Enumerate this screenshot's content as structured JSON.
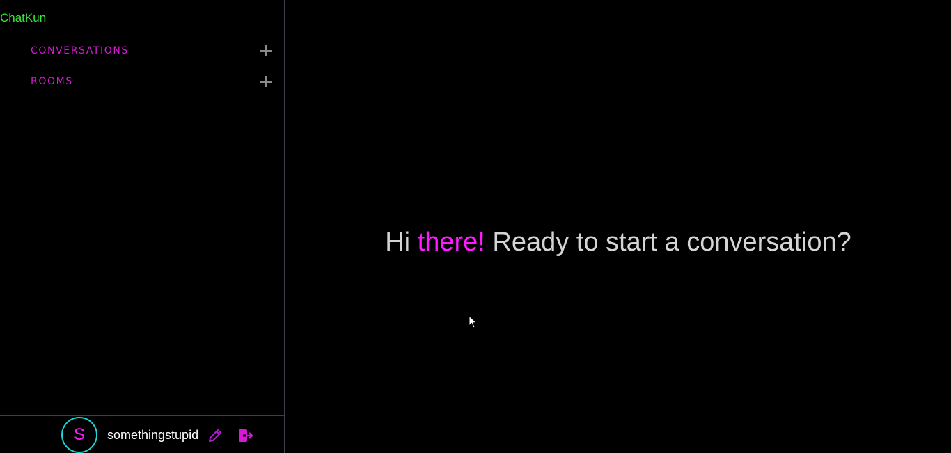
{
  "app": {
    "title": "ChatKun"
  },
  "sidebar": {
    "sections": [
      {
        "label": "CONVERSATIONS",
        "action_icon": "plus-icon"
      },
      {
        "label": "ROOMS",
        "action_icon": "plus-icon"
      }
    ]
  },
  "user": {
    "avatar_letter": "S",
    "username": "somethingstupid",
    "edit_icon": "pencil-icon",
    "logout_icon": "logout-icon"
  },
  "main": {
    "greeting": {
      "part1": "Hi ",
      "part2": "there!",
      "part3": " Ready to start a conversation?"
    }
  },
  "colors": {
    "background": "#000000",
    "brand": "#39e639",
    "accent": "#ff1aff",
    "section_label": "#d61ad6",
    "avatar_border": "#1ad6d6",
    "divider": "#3a3f4b",
    "text": "#d4d4d4"
  }
}
